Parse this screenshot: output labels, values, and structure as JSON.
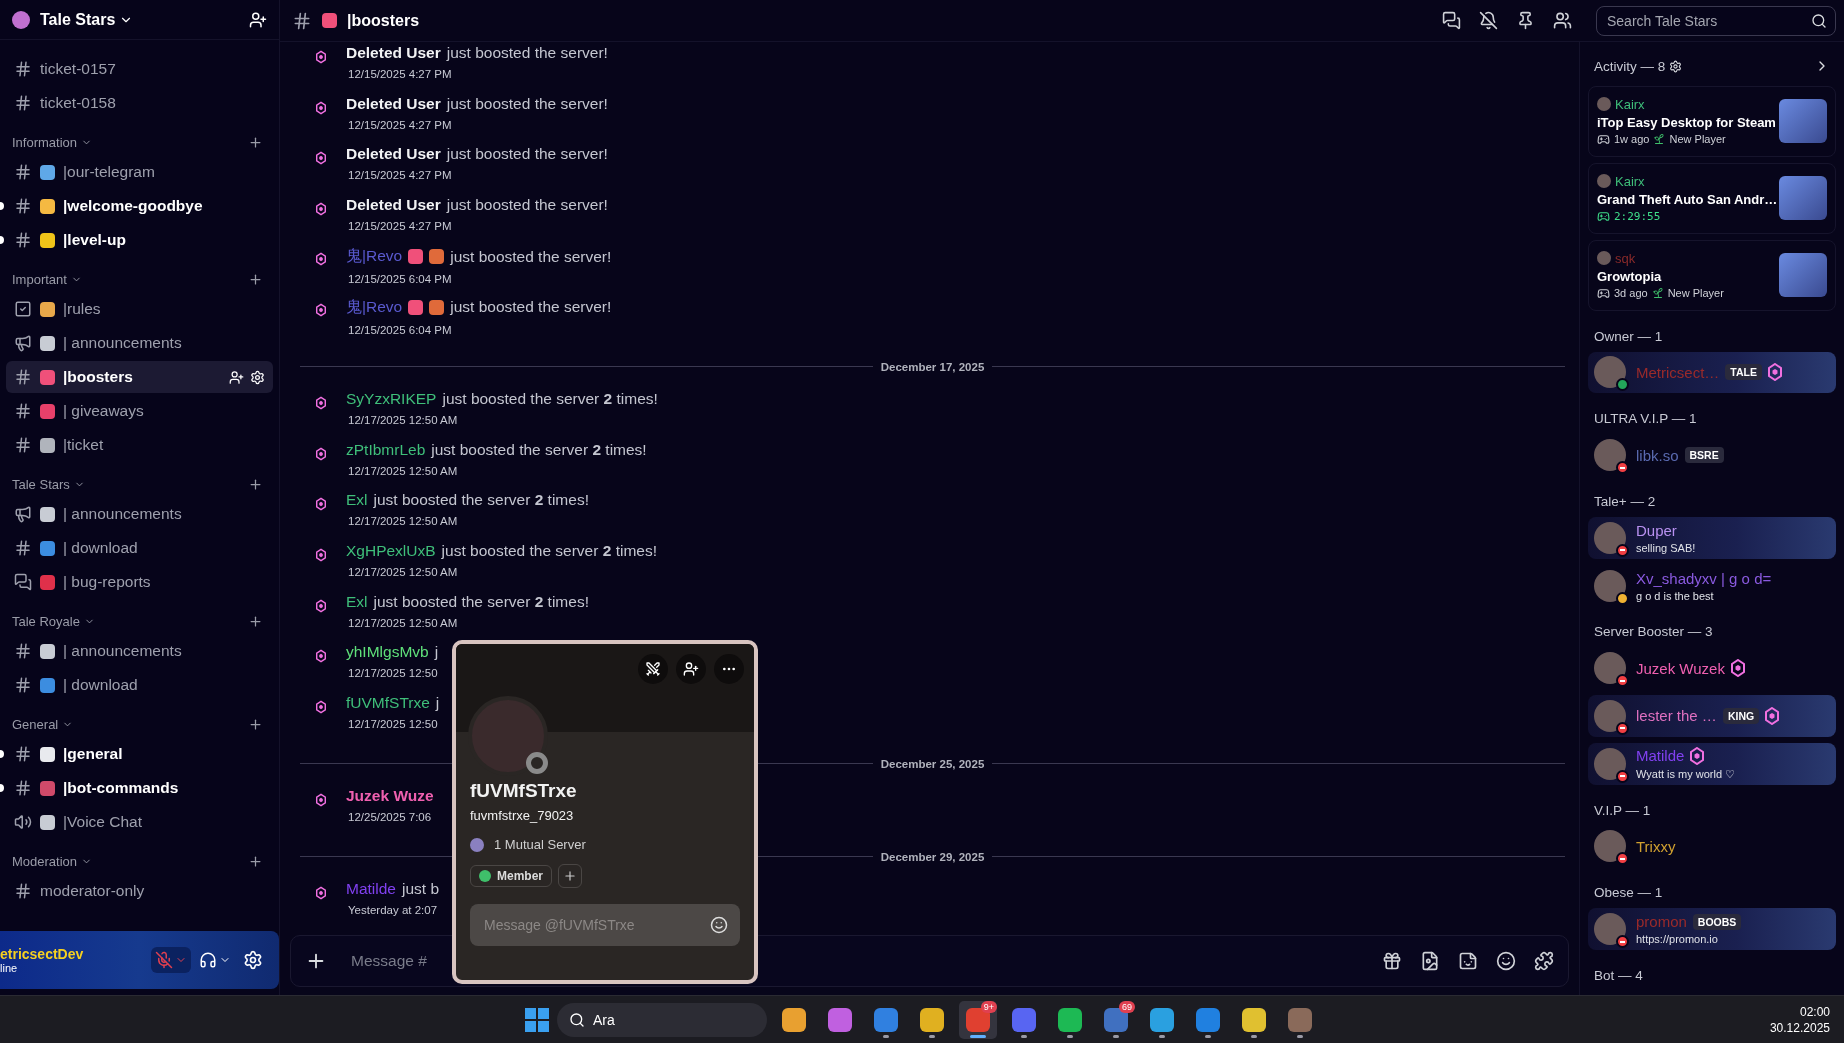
{
  "server": {
    "name": "Tale Stars"
  },
  "sidebar": {
    "channels": [
      {
        "kind": "text",
        "label": "ticket-0157",
        "unread": false,
        "selected": false
      },
      {
        "kind": "text",
        "label": "ticket-0158",
        "unread": false,
        "selected": false
      }
    ],
    "categories": [
      {
        "label": "Information",
        "channels": [
          {
            "kind": "text",
            "color": "#5fa8e8",
            "label": "|our-telegram",
            "unread": false,
            "selected": false
          },
          {
            "kind": "text",
            "color": "#f5b942",
            "label": "|welcome-goodbye",
            "unread": true,
            "selected": false
          },
          {
            "kind": "text",
            "color": "#f0c419",
            "label": "|level-up",
            "unread": true,
            "selected": false
          }
        ]
      },
      {
        "label": "Important",
        "channels": [
          {
            "kind": "rules",
            "color": "#e8a84a",
            "label": "|rules",
            "unread": false,
            "selected": false
          },
          {
            "kind": "announcement",
            "color": "#c8ccd4",
            "label": "| announcements",
            "unread": false,
            "selected": false
          },
          {
            "kind": "text",
            "color": "#f0507a",
            "label": "|boosters",
            "unread": false,
            "selected": true
          },
          {
            "kind": "text",
            "color": "#e8406a",
            "label": "| giveaways",
            "unread": false,
            "selected": false
          },
          {
            "kind": "text",
            "color": "#b0b4bc",
            "label": "|ticket",
            "unread": false,
            "selected": false
          }
        ]
      },
      {
        "label": "Tale Stars",
        "channels": [
          {
            "kind": "announcement",
            "color": "#c8ccd4",
            "label": "| announcements",
            "unread": false,
            "selected": false
          },
          {
            "kind": "text",
            "color": "#3c8de0",
            "label": "| download",
            "unread": false,
            "selected": false
          },
          {
            "kind": "forum",
            "color": "#e0304a",
            "label": "| bug-reports",
            "unread": false,
            "selected": false
          }
        ]
      },
      {
        "label": "Tale Royale",
        "channels": [
          {
            "kind": "text",
            "color": "#c8ccd4",
            "label": "| announcements",
            "unread": false,
            "selected": false
          },
          {
            "kind": "text",
            "color": "#3c8de0",
            "label": "| download",
            "unread": false,
            "selected": false
          }
        ]
      },
      {
        "label": "General",
        "channels": [
          {
            "kind": "text",
            "color": "#e8eaee",
            "label": "|general",
            "unread": true,
            "selected": false
          },
          {
            "kind": "text",
            "color": "#d04a6a",
            "label": "|bot-commands",
            "unread": true,
            "selected": false
          },
          {
            "kind": "voice",
            "color": "#c8ccd4",
            "label": "|Voice Chat",
            "unread": false,
            "selected": false
          }
        ]
      },
      {
        "label": "Moderation",
        "channels": [
          {
            "kind": "text",
            "label": "moderator-only",
            "unread": false,
            "selected": false
          }
        ]
      }
    ]
  },
  "user_panel": {
    "name": "etricsectDev",
    "status": "line"
  },
  "channel_header": {
    "name": "|boosters"
  },
  "search": {
    "placeholder": "Search Tale Stars"
  },
  "messages": [
    {
      "kind": "message",
      "name": "Deleted User",
      "color": "#f2f3f5",
      "bold": true,
      "text": "just boosted the server!",
      "time": "12/15/2025 4:27 PM"
    },
    {
      "kind": "message",
      "name": "Deleted User",
      "color": "#f2f3f5",
      "bold": true,
      "text": "just boosted the server!",
      "time": "12/15/2025 4:27 PM"
    },
    {
      "kind": "message",
      "name": "Deleted User",
      "color": "#f2f3f5",
      "bold": true,
      "text": "just boosted the server!",
      "time": "12/15/2025 4:27 PM"
    },
    {
      "kind": "message",
      "name": "Deleted User",
      "color": "#f2f3f5",
      "bold": true,
      "text": "just boosted the server!",
      "time": "12/15/2025 4:27 PM"
    },
    {
      "kind": "message",
      "name": "鬼|Revo",
      "color": "#5a5ad0",
      "bold": false,
      "emojis": [
        {
          "color": "#f0507a"
        },
        {
          "color": "#e06a3a"
        }
      ],
      "text": "just boosted the server!",
      "time": "12/15/2025 6:04 PM"
    },
    {
      "kind": "message",
      "name": "鬼|Revo",
      "color": "#5a5ad0",
      "bold": false,
      "emojis": [
        {
          "color": "#f0507a"
        },
        {
          "color": "#e06a3a"
        }
      ],
      "text": "just boosted the server!",
      "time": "12/15/2025 6:04 PM"
    },
    {
      "kind": "divider",
      "label": "December 17, 2025"
    },
    {
      "kind": "message",
      "name": "SyYzxRIKEP",
      "color": "#3fbf7a",
      "bold": false,
      "text": "just boosted the server **2** times!",
      "time": "12/17/2025 12:50 AM"
    },
    {
      "kind": "message",
      "name": "zPtIbmrLeb",
      "color": "#3fbf7a",
      "bold": false,
      "text": "just boosted the server **2** times!",
      "time": "12/17/2025 12:50 AM"
    },
    {
      "kind": "message",
      "name": "Exl",
      "color": "#3fbf7a",
      "bold": false,
      "text": "just boosted the server **2** times!",
      "time": "12/17/2025 12:50 AM"
    },
    {
      "kind": "message",
      "name": "XgHPexlUxB",
      "color": "#3fbf7a",
      "bold": false,
      "text": "just boosted the server **2** times!",
      "time": "12/17/2025 12:50 AM"
    },
    {
      "kind": "message",
      "name": "Exl",
      "color": "#3fbf7a",
      "bold": false,
      "text": "just boosted the server **2** times!",
      "time": "12/17/2025 12:50 AM"
    },
    {
      "kind": "message",
      "name": "yhIMlgsMvb",
      "color": "#5fe07a",
      "bold": false,
      "text": "j",
      "time": "12/17/2025 12:50"
    },
    {
      "kind": "message",
      "name": "fUVMfSTrxe",
      "color": "#3fbf7a",
      "bold": false,
      "text": "j",
      "time": "12/17/2025 12:50"
    },
    {
      "kind": "divider",
      "label": "December 25, 2025"
    },
    {
      "kind": "message",
      "name": "Juzek Wuze",
      "color": "#f060b0",
      "bold": true,
      "time": "12/25/2025 7:06"
    },
    {
      "kind": "divider",
      "label": "December 29, 2025"
    },
    {
      "kind": "message",
      "name": "Matilde",
      "color": "#8040f0",
      "bold": false,
      "text": "just b",
      "time": "Yesterday at 2:07"
    }
  ],
  "composer": {
    "placeholder": "Message #"
  },
  "profile_popup": {
    "display_name": "fUVMfSTrxe",
    "username": "fuvmfstrxe_79023",
    "mutual": "1 Mutual Server",
    "roles": [
      "Member"
    ],
    "placeholder": "Message @fUVMfSTrxe"
  },
  "activity": {
    "title": "Activity — 8",
    "cards": [
      {
        "user": "Kairx",
        "color": "#3fbf7a",
        "title": "iTop Easy Desktop for Steam",
        "time": "1w ago",
        "tag": "New Player",
        "live": false
      },
      {
        "user": "Kairx",
        "color": "#3fbf7a",
        "title": "Grand Theft Auto San Andr…",
        "time": "2:29:55",
        "live": true
      },
      {
        "user": "sqk",
        "color": "#8a2a2a",
        "title": "Growtopia",
        "time": "3d ago",
        "tag": "New Player",
        "live": false
      }
    ]
  },
  "member_groups": [
    {
      "title": "Owner — 1",
      "members": [
        {
          "name": "Metricsect…",
          "color": "#9a2a2a",
          "dnd": false,
          "idle": false,
          "badge": "TALE",
          "booster": true,
          "banner": true
        }
      ]
    },
    {
      "title": "ULTRA V.I.P — 1",
      "members": [
        {
          "name": "libk.so",
          "color": "#5a6ab0",
          "dnd": true,
          "idle": false,
          "badge": "BSRE",
          "booster": false,
          "banner": false
        }
      ]
    },
    {
      "title": "Tale+ — 2",
      "members": [
        {
          "name": "Duper",
          "color": "#b890f0",
          "subtitle": "selling SAB!",
          "dnd": true,
          "idle": false,
          "booster": false,
          "banner": true
        },
        {
          "name": "Xv_shadyxv | g o d=",
          "color": "#8a5ae0",
          "subtitle": "g o d is the best",
          "dnd": false,
          "idle": true,
          "booster": false,
          "banner": false
        }
      ]
    },
    {
      "title": "Server Booster — 3",
      "members": [
        {
          "name": "Juzek Wuzek",
          "color": "#f060b0",
          "dnd": true,
          "idle": false,
          "booster": true,
          "banner": false
        },
        {
          "name": "lester the …",
          "color": "#e070c0",
          "dnd": true,
          "idle": false,
          "badge": "KING",
          "booster": true,
          "banner": true
        },
        {
          "name": "Matilde",
          "color": "#8040f0",
          "subtitle": "Wyatt is my world ♡",
          "dnd": true,
          "idle": false,
          "booster": true,
          "banner": true
        }
      ]
    },
    {
      "title": "V.I.P — 1",
      "members": [
        {
          "name": "Trixxy",
          "color": "#d0a030",
          "dnd": true,
          "idle": false,
          "booster": false,
          "banner": false
        }
      ]
    },
    {
      "title": "Obese — 1",
      "members": [
        {
          "name": "promon",
          "color": "#9a2a2a",
          "subtitle": "https://promon.io",
          "dnd": true,
          "idle": false,
          "badge": "BOOBS",
          "booster": false,
          "banner": true
        }
      ]
    },
    {
      "title": "Bot — 4"
    }
  ],
  "taskbar": {
    "search": "Ara",
    "apps": [
      {
        "running": false,
        "selected": false
      },
      {
        "running": false,
        "selected": false
      },
      {
        "running": true,
        "selected": false
      },
      {
        "running": true,
        "selected": false
      },
      {
        "running": true,
        "selected": true,
        "badge": "9+"
      },
      {
        "running": true,
        "selected": false
      },
      {
        "running": true,
        "selected": false
      },
      {
        "running": true,
        "selected": false,
        "badge": "69"
      },
      {
        "running": true,
        "selected": false
      },
      {
        "running": true,
        "selected": false
      },
      {
        "running": true,
        "selected": false
      },
      {
        "running": true,
        "selected": false
      }
    ],
    "time": "02:00",
    "date": "30.12.2025"
  }
}
